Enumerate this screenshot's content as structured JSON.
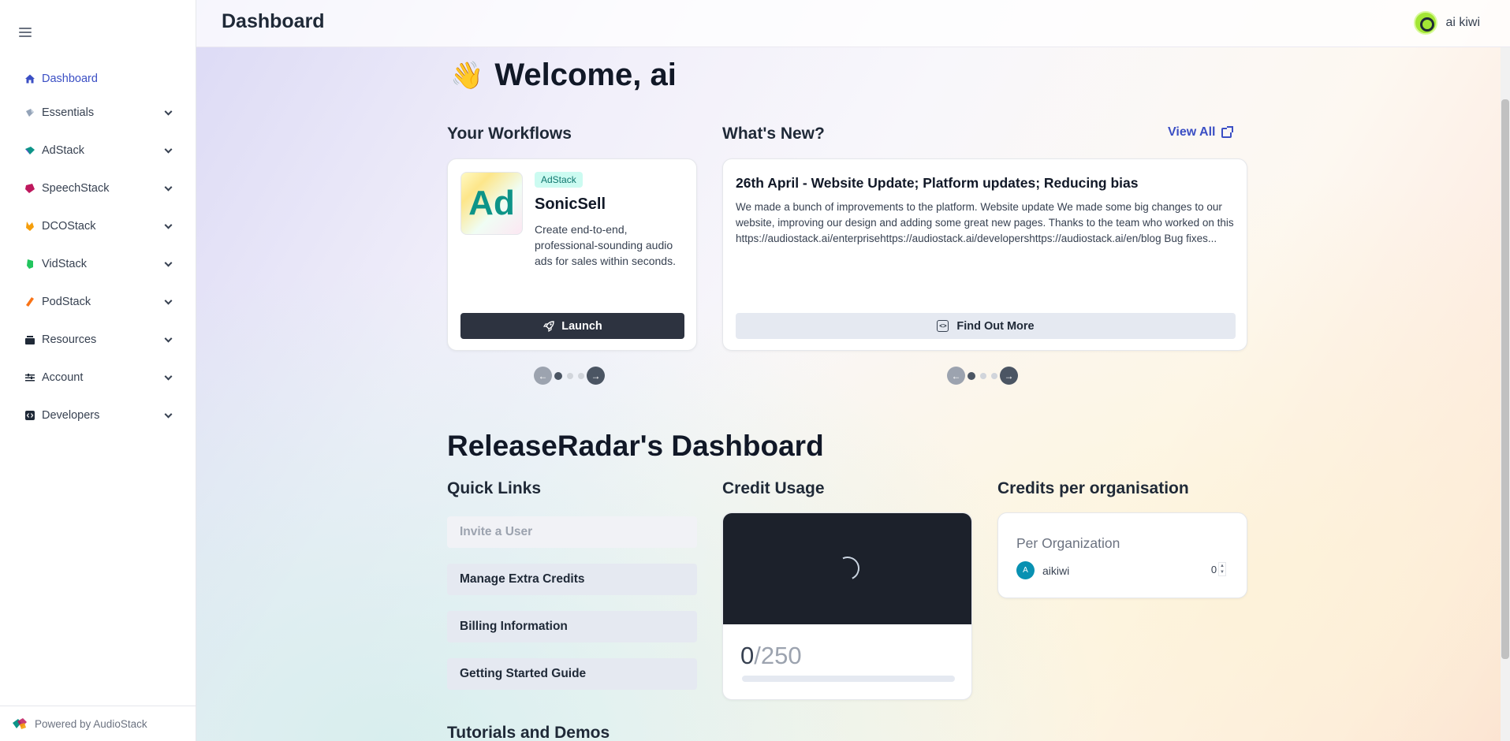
{
  "sidebar": {
    "items": [
      {
        "label": "Dashboard",
        "icon": "home-icon",
        "color": "#3b4fc4"
      },
      {
        "label": "Essentials",
        "icon": "essentials-icon",
        "color": "#94a3b8"
      },
      {
        "label": "AdStack",
        "icon": "adstack-icon",
        "color": "#0d9488"
      },
      {
        "label": "SpeechStack",
        "icon": "speechstack-icon",
        "color": "#be185d"
      },
      {
        "label": "DCOStack",
        "icon": "dcostack-icon",
        "color": "#f59e0b"
      },
      {
        "label": "VidStack",
        "icon": "vidstack-icon",
        "color": "#22c55e"
      },
      {
        "label": "PodStack",
        "icon": "podstack-icon",
        "color": "#f97316"
      },
      {
        "label": "Resources",
        "icon": "resources-icon",
        "color": "#1f2937"
      },
      {
        "label": "Account",
        "icon": "account-icon",
        "color": "#1f2937"
      },
      {
        "label": "Developers",
        "icon": "developers-icon",
        "color": "#1f2937"
      }
    ],
    "footer": "Powered by AudioStack"
  },
  "header": {
    "title": "Dashboard",
    "user_name": "ai kiwi"
  },
  "welcome": {
    "emoji": "👋",
    "text": "Welcome, ai"
  },
  "workflows": {
    "title": "Your Workflows",
    "card": {
      "thumb_text": "Ad",
      "badge": "AdStack",
      "name": "SonicSell",
      "description": "Create end-to-end, professional-sounding audio ads for sales within seconds.",
      "button": "Launch"
    }
  },
  "news": {
    "title": "What's New?",
    "view_all": "View All",
    "card": {
      "title": "26th April - Website Update; Platform updates; Reducing bias",
      "body": "We made a bunch of improvements to the platform. Website update We made some big changes to our website, improving our design and adding some great new pages. Thanks to the team who worked on this https://audiostack.ai/enterprisehttps://audiostack.ai/developershttps://audiostack.ai/en/blog Bug fixes...",
      "button": "Find Out More"
    }
  },
  "org_dashboard": {
    "title": "ReleaseRadar's Dashboard",
    "quick_links": {
      "title": "Quick Links",
      "items": [
        "Invite a User",
        "Manage Extra Credits",
        "Billing Information",
        "Getting Started Guide"
      ]
    },
    "credit_usage": {
      "title": "Credit Usage",
      "used": "0",
      "total": "/250"
    },
    "credits_per_org": {
      "title": "Credits per organisation",
      "heading": "Per Organization",
      "org_initial": "A",
      "org_name": "aikiwi",
      "value": "0"
    }
  },
  "tutorials": {
    "title": "Tutorials and Demos"
  }
}
